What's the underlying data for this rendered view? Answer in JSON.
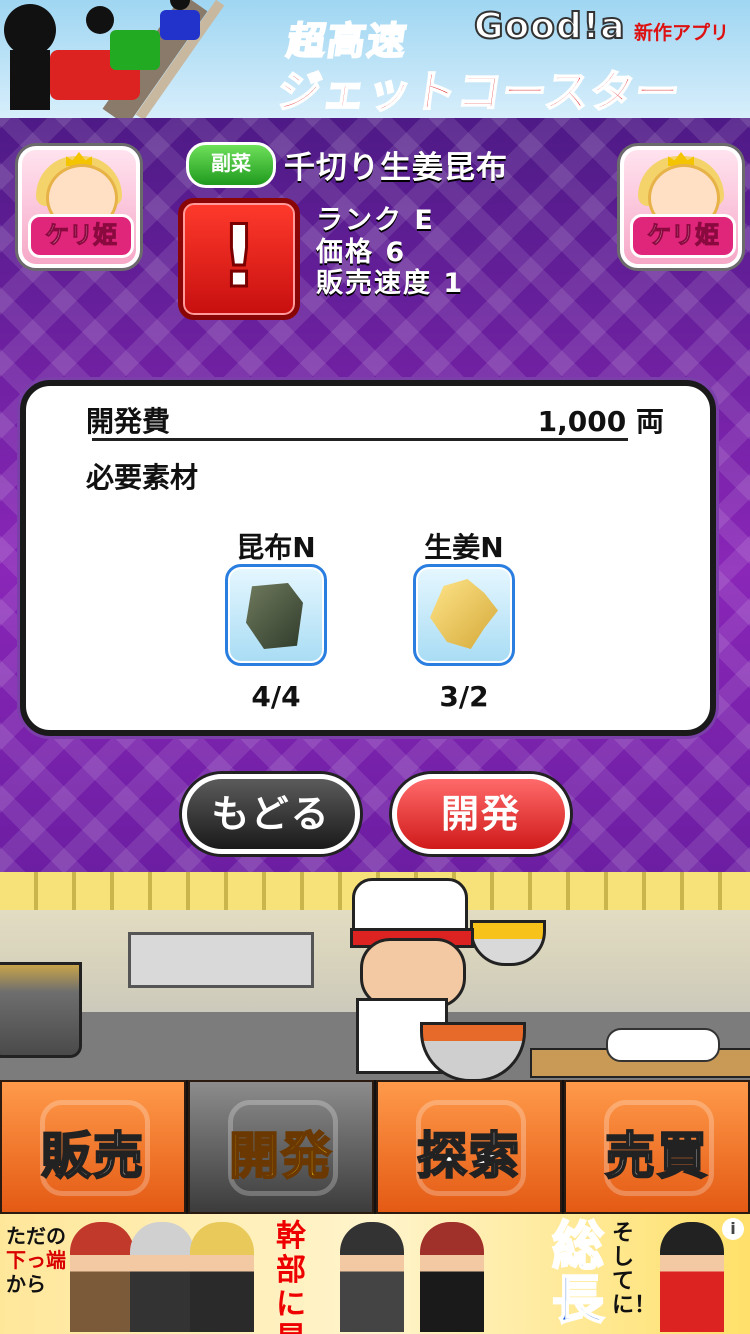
{
  "top_ad": {
    "title_line1": "超高速",
    "title_line2": "ジェットコースター",
    "brand": "Good!a",
    "brand_sub": "新作アプリ"
  },
  "header": {
    "left_badge": "ケリ姫",
    "right_badge": "ケリ姫",
    "category": "副菜",
    "dish_name": "千切り生姜昆布",
    "dish_icon_mark": "!",
    "rank": "ランク E",
    "price": "価格 6",
    "speed": "販売速度 1"
  },
  "card": {
    "cost_label": "開発費",
    "cost_value": "1,000 両",
    "materials_label": "必要素材",
    "materials": [
      {
        "name": "昆布N",
        "count": "4/4",
        "icon": "kelp-icon"
      },
      {
        "name": "生姜N",
        "count": "3/2",
        "icon": "ginger-icon"
      }
    ]
  },
  "buttons": {
    "back": "もどる",
    "develop": "開発"
  },
  "nav": {
    "items": [
      {
        "label": "販売",
        "active": false
      },
      {
        "label": "開発",
        "active": true
      },
      {
        "label": "探索",
        "active": false
      },
      {
        "label": "売買",
        "active": false
      }
    ]
  },
  "bottom_ad": {
    "text_a1": "ただの",
    "text_a2": "下っ端",
    "text_a3": "から",
    "text_b": "幹部に昇格！",
    "text_c": "総長",
    "text_d": "そして に！",
    "info": "i"
  },
  "colors": {
    "purple_bg": "#6a1d9e",
    "active_nav_text": "#ffd21a",
    "develop_button": "#d01a1a"
  }
}
